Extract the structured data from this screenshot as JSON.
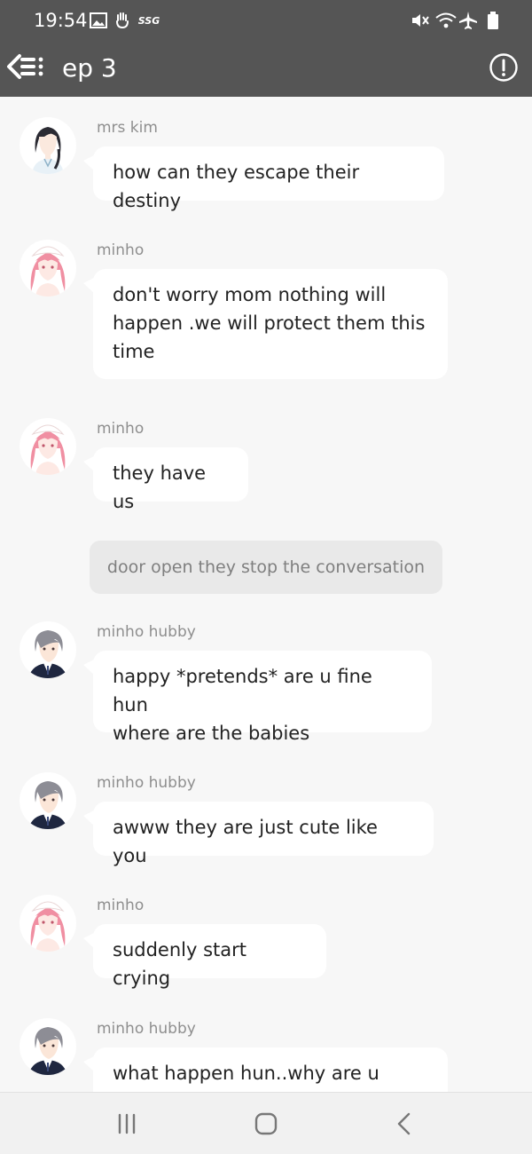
{
  "status_bar": {
    "time": "19:54",
    "carrier_badge": "SSG",
    "left_icons": [
      "image-icon",
      "hand-icon"
    ],
    "right_icons": [
      "mute-icon",
      "wifi-icon",
      "airplane-icon",
      "battery-icon"
    ]
  },
  "header": {
    "title": "ep 3",
    "back_icon": "back-list-icon",
    "info_icon": "info-icon"
  },
  "messages": [
    {
      "type": "chat",
      "sender": "mrs kim",
      "avatar": "mrs-kim-avatar",
      "lines": [
        "how can they escape their destiny"
      ]
    },
    {
      "type": "chat",
      "sender": "minho",
      "avatar": "minho-avatar",
      "lines": [
        "don't worry mom nothing will",
        "happen .we will protect them this",
        "time"
      ]
    },
    {
      "type": "chat",
      "sender": "minho",
      "avatar": "minho-avatar",
      "lines": [
        "they have us"
      ]
    },
    {
      "type": "narration",
      "text": "door open they stop the conversation"
    },
    {
      "type": "chat",
      "sender": "minho hubby",
      "avatar": "minho-hubby-avatar",
      "lines": [
        "happy *pretends*  are u fine hun",
        "where are the babies"
      ]
    },
    {
      "type": "chat",
      "sender": "minho hubby",
      "avatar": "minho-hubby-avatar",
      "lines": [
        "awww they are just cute like you"
      ]
    },
    {
      "type": "chat",
      "sender": "minho",
      "avatar": "minho-avatar",
      "lines": [
        "suddenly start crying"
      ]
    },
    {
      "type": "chat",
      "sender": "minho hubby",
      "avatar": "minho-hubby-avatar",
      "lines": [
        "what happen hun..why are u"
      ]
    }
  ],
  "nav_bar": {
    "buttons": [
      "recent-apps-icon",
      "home-icon",
      "back-icon"
    ]
  },
  "colors": {
    "header_bg": "#555555",
    "chat_bg": "#f7f7f7",
    "bubble_bg": "#ffffff",
    "narration_bg": "#e9e9e9",
    "sender_text": "#8e8e8e",
    "message_text": "#222222"
  }
}
